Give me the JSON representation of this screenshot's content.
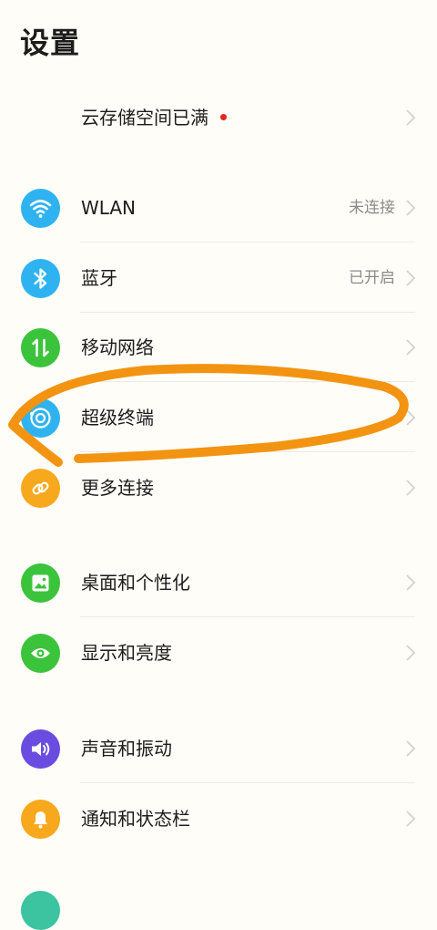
{
  "header": {
    "title": "设置"
  },
  "cloud": {
    "label": "云存储空间已满"
  },
  "connectivity": {
    "wlan": {
      "label": "WLAN",
      "value": "未连接",
      "color": "#2fb3f0"
    },
    "bluetooth": {
      "label": "蓝牙",
      "value": "已开启",
      "color": "#2fb3f0"
    },
    "mobile": {
      "label": "移动网络",
      "color": "#3cc33c"
    },
    "superterminal": {
      "label": "超级终端",
      "color": "#2fb3f0"
    },
    "more": {
      "label": "更多连接",
      "color": "#f7a81c"
    }
  },
  "personal": {
    "desktop": {
      "label": "桌面和个性化",
      "color": "#3cc33c"
    },
    "display": {
      "label": "显示和亮度",
      "color": "#3cc33c"
    }
  },
  "sound": {
    "audio": {
      "label": "声音和振动",
      "color": "#6a4de0"
    },
    "notify": {
      "label": "通知和状态栏",
      "color": "#f7a81c"
    }
  },
  "annotation": {
    "stroke_color": "#f29411"
  }
}
